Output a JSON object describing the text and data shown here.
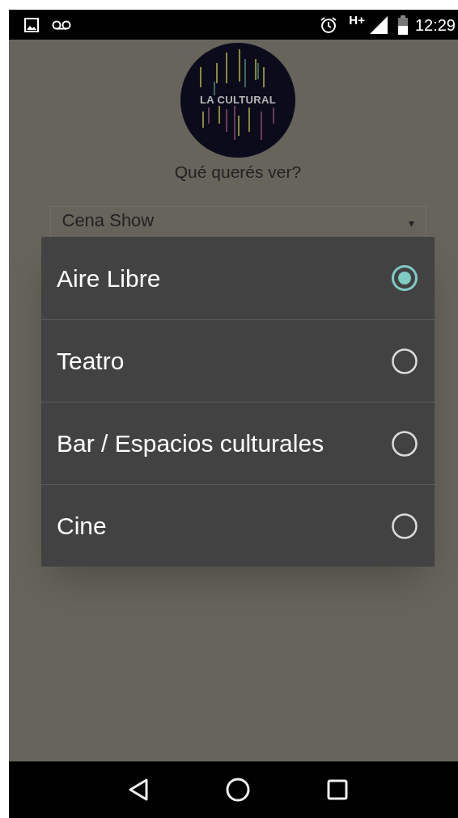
{
  "status_bar": {
    "time": "12:29",
    "network": "H+"
  },
  "logo": {
    "text": "LA CULTURAL"
  },
  "prompt": "Qué querés ver?",
  "spinner": {
    "value": "Cena Show",
    "arrow": "▾"
  },
  "dialog": {
    "options": [
      {
        "label": "Aire Libre",
        "selected": true
      },
      {
        "label": "Teatro",
        "selected": false
      },
      {
        "label": "Bar / Espacios culturales",
        "selected": false
      },
      {
        "label": "Cine",
        "selected": false
      }
    ]
  }
}
